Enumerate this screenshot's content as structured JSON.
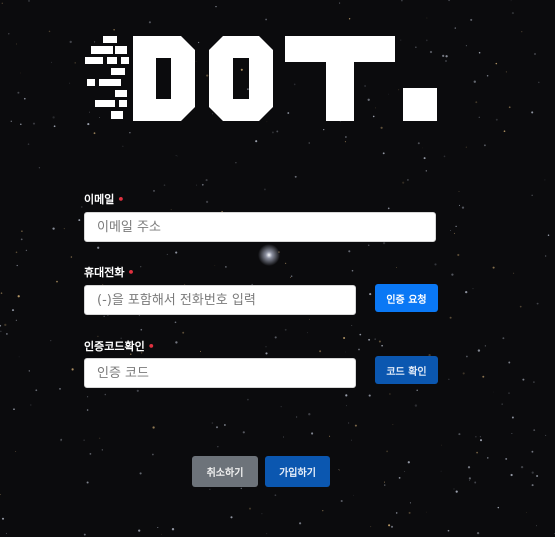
{
  "brand": {
    "logo_text": "DOT."
  },
  "form": {
    "email": {
      "label": "이메일",
      "required_mark": "•",
      "placeholder": "이메일 주소"
    },
    "phone": {
      "label": "휴대전화",
      "required_mark": "•",
      "placeholder": "(-)을 포함해서 전화번호 입력",
      "request_button": "인증 요청"
    },
    "code": {
      "label": "인증코드확인",
      "required_mark": "•",
      "placeholder": "인증 코드",
      "verify_button": "코드 확인"
    }
  },
  "actions": {
    "cancel_label": "취소하기",
    "submit_label": "가입하기"
  },
  "colors": {
    "background": "#0b0b0d",
    "primary_button": "#0a78f5",
    "dimmed_button": "#0b57b0",
    "cancel_button": "#6d737a",
    "required_mark": "#e0313f"
  }
}
